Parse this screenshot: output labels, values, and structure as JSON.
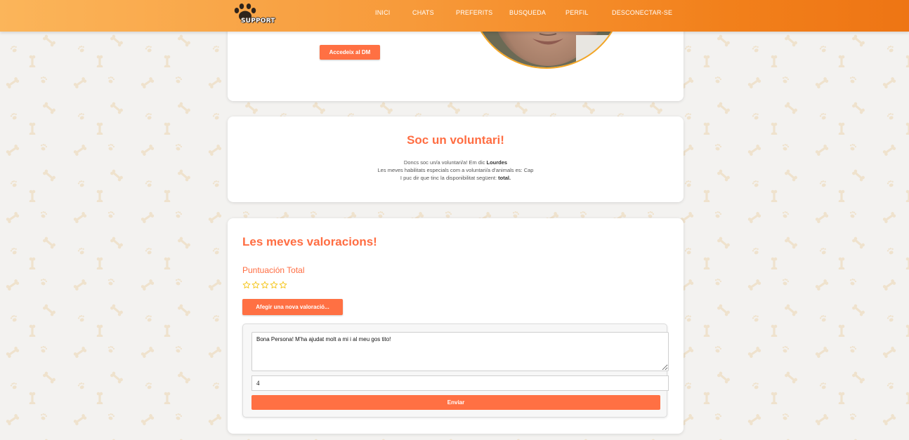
{
  "brand": {
    "logo_text": "SUPPORT",
    "gradient_start": "#fbb55a",
    "gradient_end": "#ee7514"
  },
  "nav": {
    "items": [
      {
        "label": "INICI"
      },
      {
        "label": "CHATS"
      },
      {
        "label": "PREFERITS"
      },
      {
        "label": "BUSQUEDA"
      },
      {
        "label": "PERFIL"
      },
      {
        "label": "DESCONECTAR-SE"
      }
    ]
  },
  "profile": {
    "dm_button_label": "Accedeix al DM"
  },
  "volunteer": {
    "title": "Soc un voluntari!",
    "line1_prefix": "Doncs soc un/a voluntari/a! Em dic ",
    "name": "Lourdes",
    "line2": "Les meves habilitats especials com a voluntari/a d'animals es: Cap",
    "line3_prefix": "I puc dir que tinc la disponibilitat següent: ",
    "availability": "total."
  },
  "ratings": {
    "title": "Les meves valoracions!",
    "total_label": "Puntuación Total",
    "total_score": 0,
    "max_score": 5,
    "add_button_label": "Afegir una nova valoració...",
    "form": {
      "comment_value": "Bona Persona! M'ha ajudat molt a mi i al meu gos tito!",
      "score_value": "4",
      "submit_label": "Enviar"
    }
  },
  "colors": {
    "accent": "#ff6d42",
    "button": "#ff7043",
    "star": "#f5c518",
    "pattern": "#efe2cd"
  }
}
